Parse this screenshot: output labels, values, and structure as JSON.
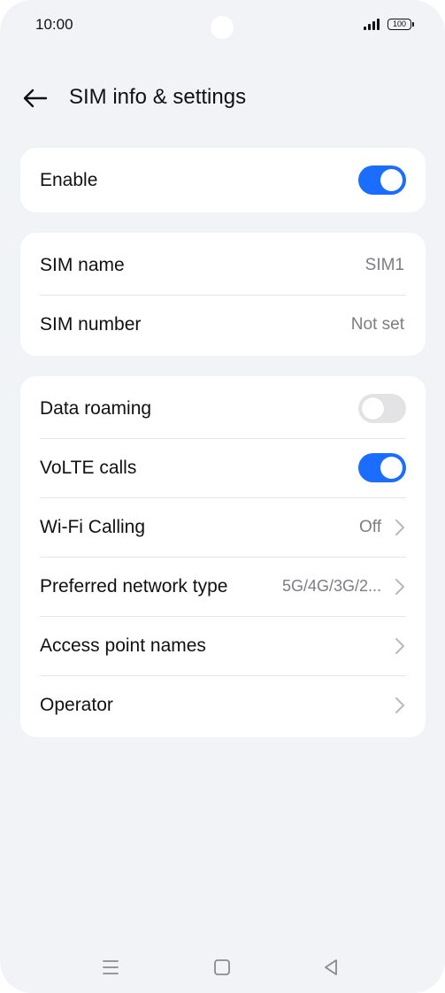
{
  "status_bar": {
    "time": "10:00",
    "battery": "100"
  },
  "header": {
    "title": "SIM info & settings",
    "back_icon": "arrow-left-icon"
  },
  "cards": {
    "enable": {
      "label": "Enable",
      "toggle_on": true
    },
    "sim": {
      "rows": [
        {
          "label": "SIM name",
          "value": "SIM1"
        },
        {
          "label": "SIM number",
          "value": "Not set"
        }
      ]
    },
    "network": {
      "rows": [
        {
          "label": "Data roaming",
          "toggle_on": false
        },
        {
          "label": "VoLTE calls",
          "toggle_on": true
        },
        {
          "label": "Wi-Fi Calling",
          "value": "Off"
        },
        {
          "label": "Preferred network type",
          "value": "5G/4G/3G/2..."
        },
        {
          "label": "Access point names"
        },
        {
          "label": "Operator"
        }
      ]
    }
  },
  "colors": {
    "accent": "#1a6dff",
    "background": "#f2f3f7",
    "card": "#ffffff"
  },
  "nav_bar": {
    "icons": [
      "menu-icon",
      "home-square-icon",
      "back-triangle-icon"
    ]
  }
}
